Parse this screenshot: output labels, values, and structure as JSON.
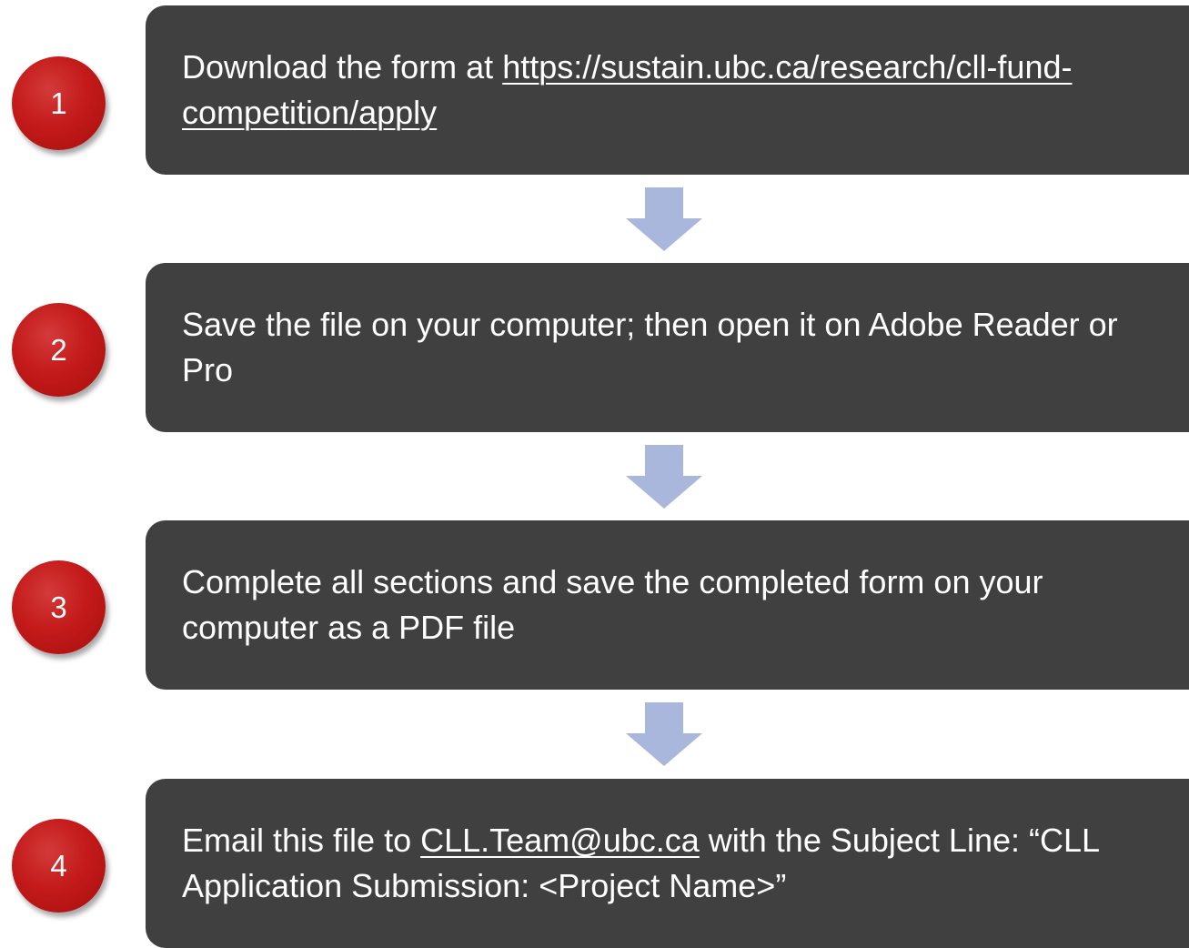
{
  "steps": [
    {
      "number": "1",
      "text_before": "Download the form at ",
      "link_text": "https://sustain.ubc.ca/research/cll-fund-competition/apply",
      "text_after": ""
    },
    {
      "number": "2",
      "text": "Save the file on your computer; then open it on Adobe Reader or Pro"
    },
    {
      "number": "3",
      "text": "Complete all sections and save the completed form on your computer as a PDF file"
    },
    {
      "number": "4",
      "text_before": "Email this file to ",
      "link_text": "CLL.Team@ubc.ca",
      "text_after": " with the Subject Line: “CLL Application Submission: <Project Name>”"
    }
  ],
  "colors": {
    "box": "#404040",
    "circle": "#c41a1a",
    "arrow": "#aab7dd",
    "text": "#ffffff"
  },
  "icons": {
    "arrow": "arrow-down-icon"
  }
}
